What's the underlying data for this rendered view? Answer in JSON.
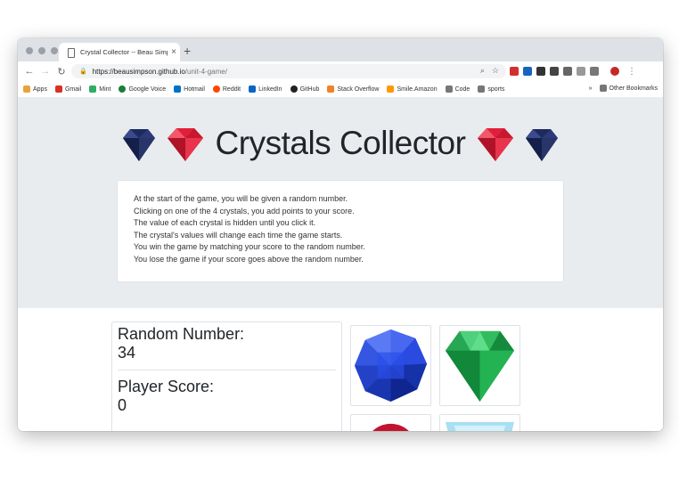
{
  "browser": {
    "tab_title": "Crystal Collector -- Beau Simp",
    "new_tab": "+",
    "tab_close": "×",
    "url_host": "https://beausimpson.github.io",
    "url_path": "/unit-4-game/"
  },
  "bookmarks": [
    "Apps",
    "Gmail",
    "Mint",
    "Google Voice",
    "Hotmail",
    "Reddit",
    "LinkedIn",
    "GitHub",
    "Stack Overflow",
    "Smile.Amazon",
    "Code",
    "sports"
  ],
  "other_bookmarks": "Other Bookmarks",
  "page": {
    "title": "Crystals Collector",
    "instructions": [
      "At the start of the game, you will be given a random number.",
      "Clicking on one of the 4 crystals, you add points to your score.",
      "The value of each crystal is hidden until you click it.",
      "The crystal's values will change each time the game starts.",
      "You win the game by matching your score to the random number.",
      "You lose the game if your score goes above the random number."
    ],
    "random_label": "Random Number:",
    "random_value": "34",
    "score_label": "Player Score:",
    "score_value": "0"
  },
  "colors": {
    "hero_bg": "#e9ecef",
    "ruby": "#e0203a",
    "sapphire_dark": "#1d2a5e",
    "blue_crystal": "#1f3fd0",
    "green_crystal": "#1ca64a"
  }
}
